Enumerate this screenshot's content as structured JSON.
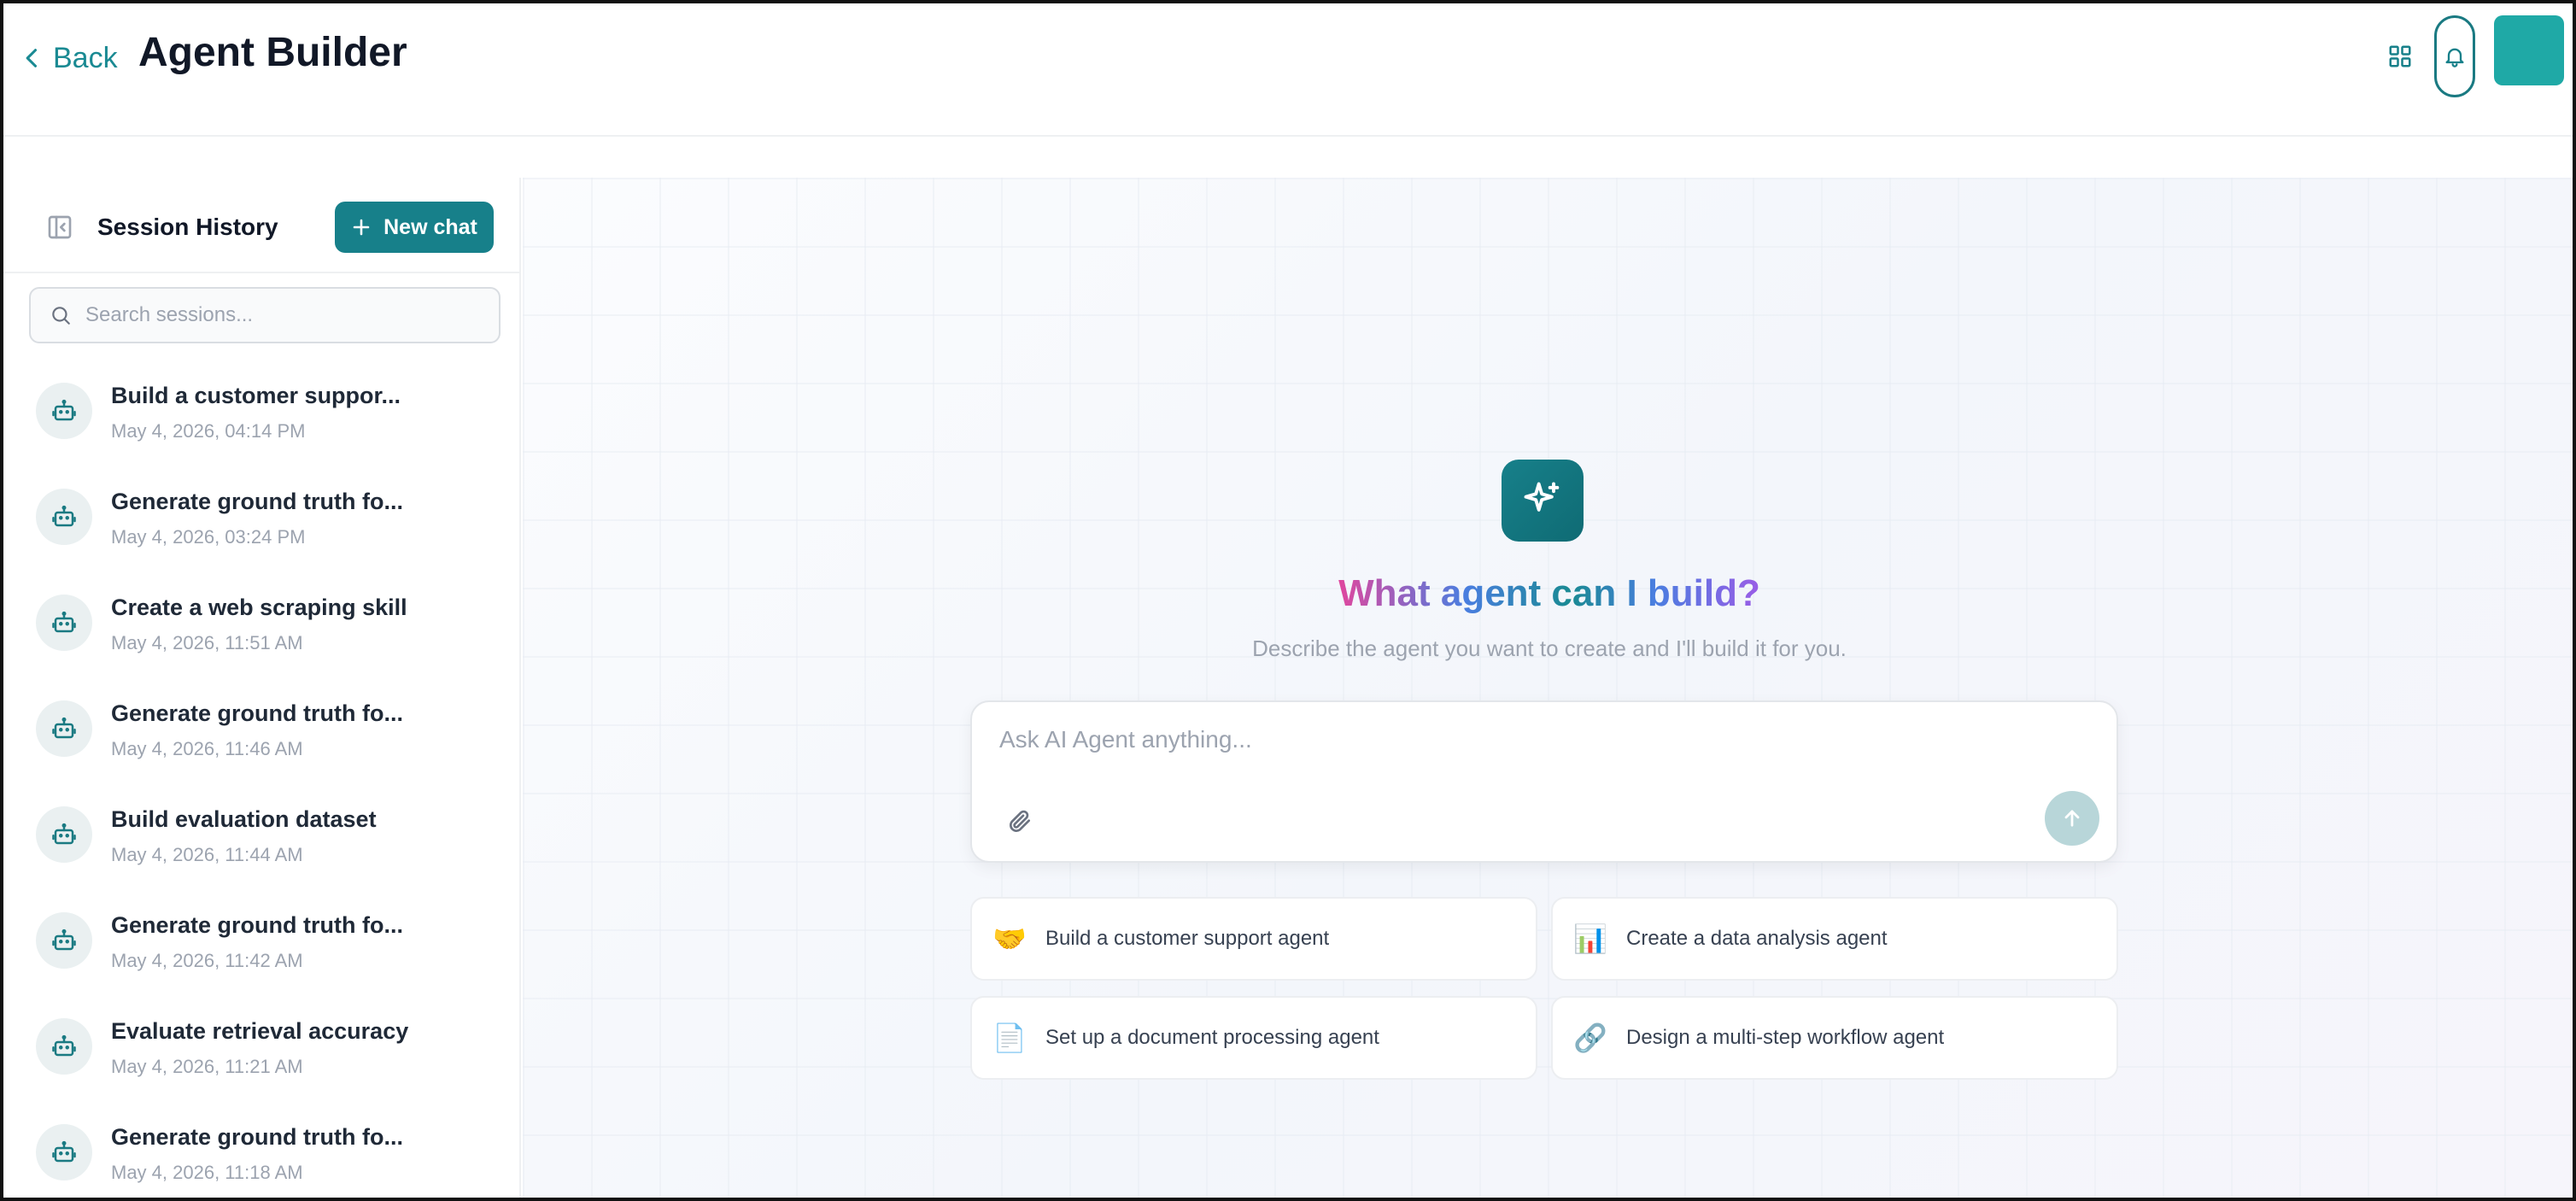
{
  "header": {
    "back_label": "Back",
    "title": "Agent Builder",
    "icons": [
      "grid-icon",
      "bell-icon"
    ]
  },
  "sidebar": {
    "title": "Session History",
    "new_chat_label": "New chat",
    "search_placeholder": "Search sessions...",
    "sessions": [
      {
        "name": "Build a customer suppor...",
        "date": "May 4, 2026, 04:14 PM"
      },
      {
        "name": "Generate ground truth fo...",
        "date": "May 4, 2026, 03:24 PM"
      },
      {
        "name": "Create a web scraping skill",
        "date": "May 4, 2026, 11:51 AM"
      },
      {
        "name": "Generate ground truth fo...",
        "date": "May 4, 2026, 11:46 AM"
      },
      {
        "name": "Build evaluation dataset",
        "date": "May 4, 2026, 11:44 AM"
      },
      {
        "name": "Generate ground truth fo...",
        "date": "May 4, 2026, 11:42 AM"
      },
      {
        "name": "Evaluate retrieval accuracy",
        "date": "May 4, 2026, 11:21 AM"
      },
      {
        "name": "Generate ground truth fo...",
        "date": "May 4, 2026, 11:18 AM"
      }
    ]
  },
  "main": {
    "hero_title": "What agent can I build?",
    "hero_subtitle": "Describe the agent you want to create and I'll build it for you.",
    "composer_placeholder": "Ask AI Agent anything...",
    "suggestions": [
      {
        "emoji": "🤝",
        "label": "Build a customer support agent"
      },
      {
        "emoji": "📊",
        "label": "Create a data analysis agent"
      },
      {
        "emoji": "📄",
        "label": "Set up a document processing agent"
      },
      {
        "emoji": "🔗",
        "label": "Design a multi-step workflow agent"
      }
    ]
  },
  "colors": {
    "accent": "#17808a",
    "avatar": "#1fa9a6",
    "send_disabled": "#b8d6d9"
  }
}
